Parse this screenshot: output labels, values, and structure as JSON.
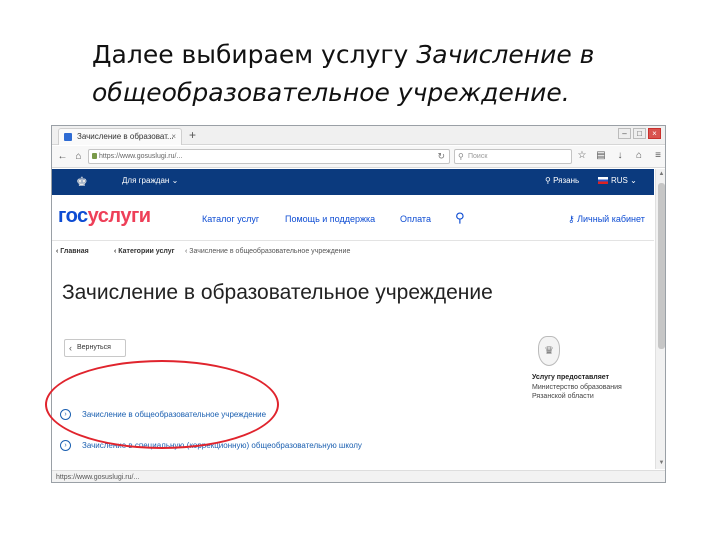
{
  "slide": {
    "title_plain": "Далее выбираем услугу ",
    "title_italic": "Зачисление в общеобразовательное учреждение."
  },
  "browser": {
    "tab_title": "Зачисление в образоват...",
    "tab_close": "×",
    "new_tab": "+",
    "url": "https://www.gosuslugi.ru/...",
    "search_placeholder": "Поиск",
    "status_url": "https://www.gosuslugi.ru/..."
  },
  "portal": {
    "citizen_menu": "Для граждан",
    "location": "Рязань",
    "language": "RUS",
    "logo_gos": "гос",
    "logo_uslugi": "услуги",
    "nav": [
      "Каталог услуг",
      "Помощь и поддержка",
      "Оплата"
    ],
    "cabinet": "Личный кабинет",
    "breadcrumbs": [
      "Главная",
      "Категории услуг",
      "Зачисление в общеобразовательное учреждение"
    ],
    "page_heading": "Зачисление в образовательное учреждение",
    "back_button": "Вернуться",
    "services": [
      "Зачисление в общеобразовательное учреждение",
      "Зачисление в специальную (коррекционную) общеобразовательную школу"
    ],
    "provider": {
      "title": "Услугу предоставляет",
      "name": "Министерство образования\nРязанской области"
    }
  },
  "colors": {
    "portal_navy": "#0b3a7e",
    "logo_blue": "#0d4cd3",
    "logo_red": "#ee3f58",
    "highlight_red": "#e0242d"
  },
  "icons": {
    "emblem": "coat-of-arms-icon",
    "search": "search-icon",
    "location": "location-pin-icon",
    "cabinet": "key-icon"
  }
}
